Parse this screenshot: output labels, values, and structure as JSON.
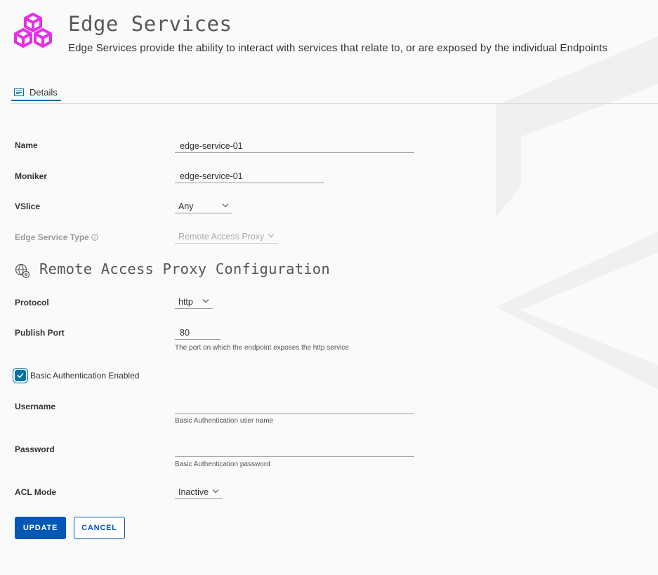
{
  "header": {
    "title": "Edge Services",
    "description": "Edge Services provide the ability to interact with services that relate to, or are exposed by the individual Endpoints",
    "logo_color": "#e62ee6"
  },
  "tabs": [
    {
      "label": "Details",
      "active": true
    }
  ],
  "form": {
    "name": {
      "label": "Name",
      "value": "edge-service-01"
    },
    "moniker": {
      "label": "Moniker",
      "value": "edge-service-01"
    },
    "vslice": {
      "label": "VSlice",
      "value": "Any"
    },
    "edge_service_type": {
      "label": "Edge Service Type",
      "value": "Remote Access Proxy"
    }
  },
  "proxy_config": {
    "section_title": "Remote Access Proxy Configuration",
    "protocol": {
      "label": "Protocol",
      "value": "http"
    },
    "publish_port": {
      "label": "Publish Port",
      "value": "80",
      "helper": "The port on which the endpoint exposes the http service"
    },
    "basic_auth": {
      "label": "Basic Authentication Enabled",
      "checked": true
    },
    "username": {
      "label": "Username",
      "value": "",
      "helper": "Basic Authentication user name"
    },
    "password": {
      "label": "Password",
      "value": "",
      "helper": "Basic Authentication password"
    },
    "acl_mode": {
      "label": "ACL Mode",
      "value": "Inactive"
    }
  },
  "actions": {
    "update_label": "UPDATE",
    "cancel_label": "CANCEL"
  },
  "colors": {
    "accent": "#0072a3",
    "primary_button": "#0057b5"
  }
}
